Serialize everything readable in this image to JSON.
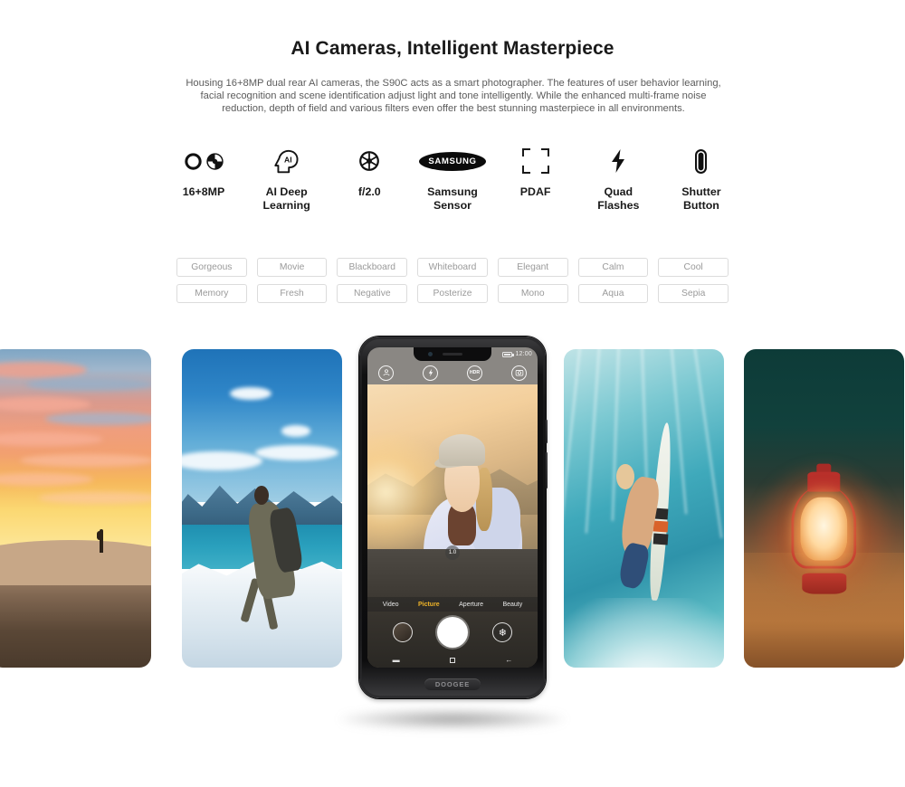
{
  "header": {
    "title": "AI Cameras, Intelligent Masterpiece",
    "description": "Housing 16+8MP dual rear AI cameras, the S90C acts as a smart photographer. The features of user behavior learning, facial recognition and scene identification adjust light and tone intelligently. While the enhanced multi-frame noise reduction, depth of field and various filters even offer the best stunning masterpiece in all environments."
  },
  "features": [
    {
      "icon": "dual-aperture-icon",
      "label": "16+8MP"
    },
    {
      "icon": "ai-head-icon",
      "label": "AI Deep\nLearning"
    },
    {
      "icon": "aperture-wheel-icon",
      "label": "f/2.0"
    },
    {
      "icon": "samsung-logo-icon",
      "label": "Samsung\nSensor",
      "brand_text": "SAMSUNG"
    },
    {
      "icon": "focus-brackets-icon",
      "label": "PDAF"
    },
    {
      "icon": "lightning-bolt-icon",
      "label": "Quad\nFlashes"
    },
    {
      "icon": "shutter-pill-icon",
      "label": "Shutter\nButton"
    }
  ],
  "filters": [
    "Gorgeous",
    "Movie",
    "Blackboard",
    "Whiteboard",
    "Elegant",
    "Calm",
    "Cool",
    "Memory",
    "Fresh",
    "Negative",
    "Posterize",
    "Mono",
    "Aqua",
    "Sepia"
  ],
  "gallery": [
    {
      "name": "desert-sunset-photo",
      "caption": "Desert sunset with lone hiker silhouette"
    },
    {
      "name": "mountain-hiker-photo",
      "caption": "Hiker with backpack on snowy mountain ridge"
    },
    {
      "name": "underwater-surfer-photo",
      "caption": "Surfer holding board underwater in turquoise sea"
    },
    {
      "name": "red-lantern-photo",
      "caption": "Glowing red lantern on sand at dusk"
    }
  ],
  "phone": {
    "brand": "DOOGEE",
    "status": {
      "time": "12:00",
      "battery": "battery-icon"
    },
    "camera_top_icons": [
      {
        "name": "ai-scene-icon",
        "glyph": "Ⓐ"
      },
      {
        "name": "flash-icon",
        "glyph": "⚡"
      },
      {
        "name": "hdr-icon",
        "glyph": "HDR"
      },
      {
        "name": "switch-camera-icon",
        "glyph": "◎"
      }
    ],
    "zoom_level": "1.0",
    "modes": [
      {
        "label": "Video",
        "active": false
      },
      {
        "label": "Picture",
        "active": true
      },
      {
        "label": "Aperture",
        "active": false
      },
      {
        "label": "Beauty",
        "active": false
      }
    ],
    "controls": {
      "gallery_thumb": "gallery-thumbnail",
      "shutter": "shutter-button",
      "filter": "filter-button"
    },
    "navbar": [
      {
        "name": "recents-button",
        "glyph": "▬"
      },
      {
        "name": "home-button",
        "glyph": "□"
      },
      {
        "name": "back-button",
        "glyph": "←"
      }
    ],
    "viewfinder_subject": "Smiling woman in lilac jacket with cap at golden hour"
  },
  "colors": {
    "accent": "#f0b429",
    "text_dark": "#1a1a1a",
    "text_muted": "#5b5b5b",
    "tag_border": "#dcdcdc",
    "tag_text": "#9a9a9a",
    "background": "#ffffff"
  }
}
